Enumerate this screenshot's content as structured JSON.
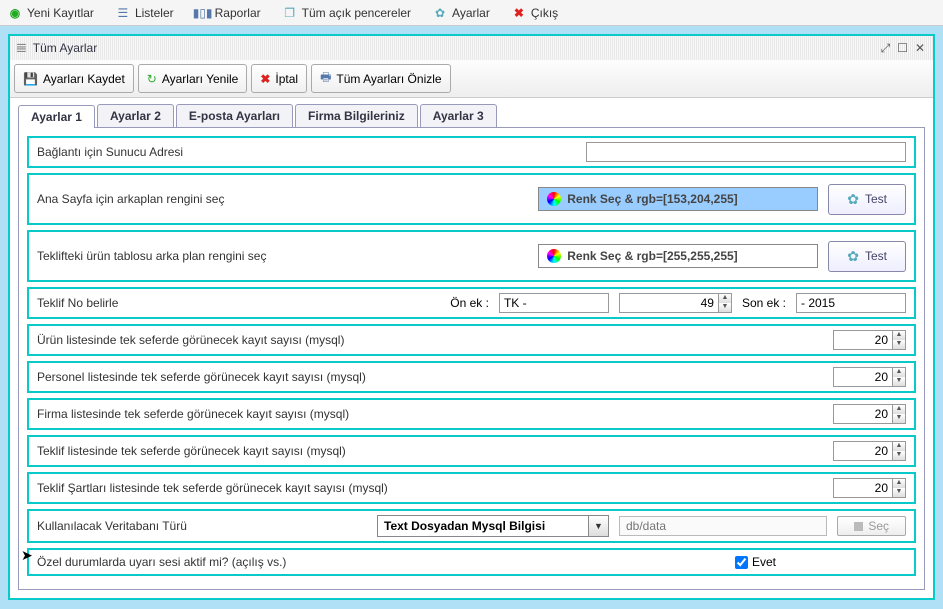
{
  "menubar": {
    "new_records": "Yeni Kayıtlar",
    "lists": "Listeler",
    "reports": "Raporlar",
    "all_windows": "Tüm açık pencereler",
    "settings": "Ayarlar",
    "exit": "Çıkış"
  },
  "window": {
    "title": "Tüm Ayarlar"
  },
  "toolbar": {
    "save": "Ayarları Kaydet",
    "refresh": "Ayarları Yenile",
    "cancel": "İptal",
    "preview": "Tüm Ayarları Önizle"
  },
  "tabs": {
    "t1": "Ayarlar 1",
    "t2": "Ayarlar 2",
    "t3": "E-posta Ayarları",
    "t4": "Firma Bilgileriniz",
    "t5": "Ayarlar 3"
  },
  "rows": {
    "server_addr": "Bağlantı için Sunucu Adresi",
    "server_addr_value": "",
    "bg_home": "Ana Sayfa için arkaplan rengini seç",
    "bg_home_btn": "Renk Seç  &  rgb=[153,204,255]",
    "bg_quote": "Teklifteki ürün tablosu arka plan rengini seç",
    "bg_quote_btn": "Renk Seç  &  rgb=[255,255,255]",
    "test": "Test",
    "quote_no": "Teklif No belirle",
    "prefix_lbl": "Ön ek :",
    "prefix_val": "TK -",
    "counter_val": "49",
    "suffix_lbl": "Son ek :",
    "suffix_val": "- 2015",
    "products": "Ürün listesinde tek seferde görünecek kayıt sayısı (mysql)",
    "products_val": "20",
    "staff": "Personel listesinde tek seferde görünecek kayıt sayısı (mysql)",
    "staff_val": "20",
    "firms": "Firma listesinde tek seferde görünecek kayıt sayısı (mysql)",
    "firms_val": "20",
    "quotes": "Teklif listesinde tek seferde görünecek kayıt sayısı (mysql)",
    "quotes_val": "20",
    "terms": "Teklif Şartları listesinde tek seferde görünecek kayıt sayısı (mysql)",
    "terms_val": "20",
    "db_type": "Kullanılacak Veritabanı Türü",
    "db_select": "Text Dosyadan Mysql Bilgisi",
    "db_path_placeholder": "db/data",
    "db_sec": "Seç",
    "alert_sound": "Özel durumlarda uyarı sesi aktif mi? (açılış vs.)",
    "evet": "Evet"
  }
}
